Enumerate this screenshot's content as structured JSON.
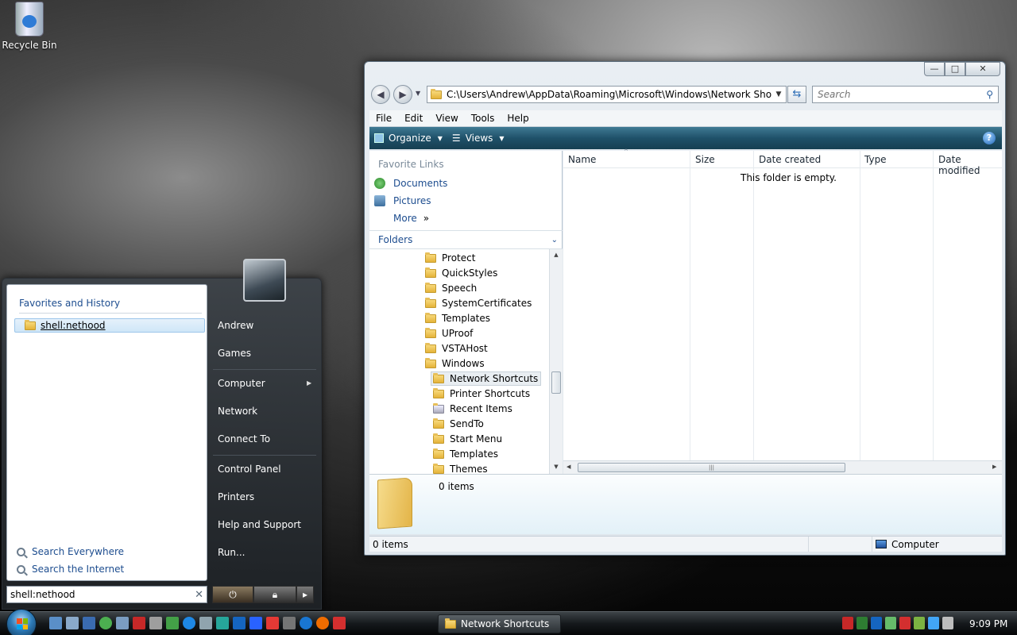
{
  "desktop": {
    "recycle_bin_label": "Recycle Bin"
  },
  "explorer": {
    "window_controls": {
      "minimize": "—",
      "maximize": "□",
      "close": "✕"
    },
    "address_path": "C:\\Users\\Andrew\\AppData\\Roaming\\Microsoft\\Windows\\Network Shortcuts",
    "search_placeholder": "Search",
    "menu": [
      "File",
      "Edit",
      "View",
      "Tools",
      "Help"
    ],
    "toolbar": {
      "organize": "Organize",
      "views": "Views"
    },
    "favorite_links": {
      "title": "Favorite Links",
      "items": [
        "Documents",
        "Pictures"
      ],
      "more": "More"
    },
    "folders_label": "Folders",
    "tree": [
      "Protect",
      "QuickStyles",
      "Speech",
      "SystemCertificates",
      "Templates",
      "UProof",
      "VSTAHost",
      "Windows",
      "Network Shortcuts",
      "Printer Shortcuts",
      "Recent Items",
      "SendTo",
      "Start Menu",
      "Templates",
      "Themes"
    ],
    "columns": [
      "Name",
      "Size",
      "Date created",
      "Type",
      "Date modified"
    ],
    "empty_message": "This folder is empty.",
    "details_items": "0 items",
    "status": {
      "items": "0 items",
      "location": "Computer"
    }
  },
  "start_menu": {
    "favorites_header": "Favorites and History",
    "history_entry": "shell:nethood",
    "search_everywhere": "Search Everywhere",
    "search_internet": "Search the Internet",
    "search_value": "shell:nethood",
    "right_items": {
      "andrew": "Andrew",
      "games": "Games",
      "computer": "Computer",
      "network": "Network",
      "connect_to": "Connect To",
      "control_panel": "Control Panel",
      "printers": "Printers",
      "help_support": "Help and Support",
      "run": "Run..."
    }
  },
  "taskbar": {
    "task_label": "Network Shortcuts",
    "clock": "9:09 PM"
  },
  "colors": {
    "toolbar": "#1f5169",
    "link": "#1d4d8f",
    "taskbar": "#15191c"
  }
}
